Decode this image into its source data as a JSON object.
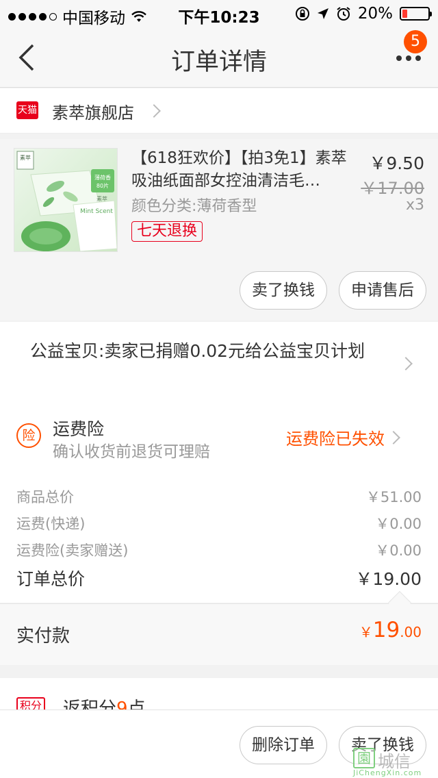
{
  "status_bar": {
    "carrier": "中国移动",
    "time": "下午10:23",
    "battery": "20%",
    "battery_level": 0.2,
    "icons": [
      "signal-dots",
      "wifi-icon",
      "rotation-lock-icon",
      "location-arrow-icon",
      "alarm-icon",
      "battery-icon"
    ]
  },
  "nav": {
    "title": "订单详情",
    "badge": "5"
  },
  "shop": {
    "badge": "天猫",
    "name": "素萃旗舰店"
  },
  "item": {
    "title": "【618狂欢价】【拍3免1】素萃吸油纸面部女控油清洁毛…",
    "sku": "颜色分类:薄荷香型",
    "tag": "七天退换",
    "price": "￥9.50",
    "original_price": "￥17.00",
    "quantity": "x3",
    "image_text": {
      "brand": "素萃",
      "flavor": "薄荷香",
      "count": "80片",
      "product": "Mint Scent"
    },
    "actions": {
      "sell": "卖了换钱",
      "after_sale": "申请售后"
    }
  },
  "donation": {
    "text": "公益宝贝:卖家已捐赠0.02元给公益宝贝计划"
  },
  "insurance": {
    "icon_text": "险",
    "title": "运费险",
    "subtitle": "确认收货前退货可理赔",
    "status": "运费险已失效"
  },
  "summary": {
    "lines": [
      {
        "label": "商品总价",
        "value": "￥51.00"
      },
      {
        "label": "运费(快递)",
        "value": "￥0.00"
      },
      {
        "label": "运费险(卖家赠送)",
        "value": "￥0.00"
      }
    ],
    "total_label": "订单总价",
    "total_value": "￥19.00"
  },
  "paid": {
    "label": "实付款",
    "currency": "￥",
    "integer": "19",
    "decimal": ".00"
  },
  "points": {
    "icon_text": "积分",
    "prefix": "返积分",
    "number": "9",
    "suffix": "点"
  },
  "bottom_bar": {
    "delete": "删除订单",
    "sell": "卖了换钱"
  },
  "watermark": {
    "box": "園",
    "text": "城信",
    "url": "JiChengXin.com"
  },
  "colors": {
    "accent": "#ff5000",
    "tmall_red": "#e8001c",
    "muted": "#999999"
  }
}
